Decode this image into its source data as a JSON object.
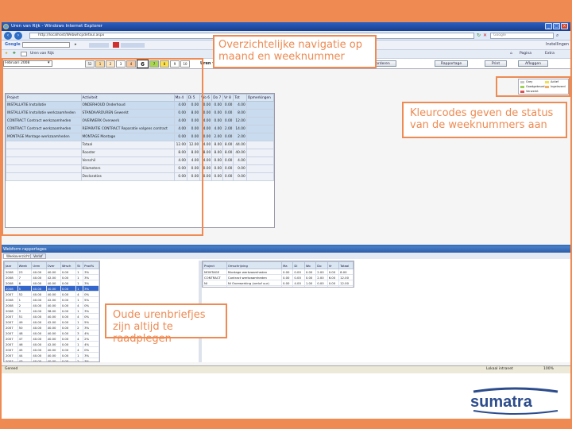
{
  "browser": {
    "title": "Uren van Rijk - Windows Internet Explorer",
    "url": "http://localhost/Webwhcpdefaul.aspx",
    "search_placeholder": "Google",
    "google_label": "Google",
    "favorites_item": "Uren van Rijk",
    "page_menu": "Pagina",
    "extra_menu": "Extra",
    "tools_menu": "Instellingen"
  },
  "app": {
    "week_select": "Februari 2008",
    "weeks": [
      "52",
      "1",
      "2",
      "3",
      "4",
      "6",
      "7",
      "8",
      "9",
      "10"
    ],
    "selected_week": "6",
    "header_text": "Uren van Rijk",
    "btn_accorderen": "Accorderen",
    "btn_rapportage": "Rapportage",
    "btn_print": "Print",
    "btn_afloggen": "Afloggen",
    "week_colors": {
      "52": "#f4f4f4",
      "1": "#f8d7a0",
      "2": "#fde6c4",
      "3": "#ffffff",
      "4": "#f9c79a",
      "6": "#ffffff",
      "7": "#a8d650",
      "8": "#fbe04a",
      "9": "#ffffff",
      "10": "#ffffff"
    }
  },
  "legend": {
    "items": [
      {
        "label": "Grey",
        "color": "#c8c8c8"
      },
      {
        "label": "Actief",
        "color": "#f0e050"
      },
      {
        "label": "Goedgekeurd",
        "color": "#9ccf55"
      },
      {
        "label": "Ingeleverd",
        "color": "#f0b060"
      },
      {
        "label": "Verwerkt",
        "color": "#e05050"
      }
    ]
  },
  "hours_table": {
    "headers": [
      "Project",
      "Activiteit",
      "Ma 4",
      "Di 5",
      "Wo 6",
      "Do 7",
      "Vr 8",
      "Tot",
      "Opmerkingen"
    ],
    "rows": [
      {
        "project": "INSTALLATIE Installatie",
        "activity": "ONDERHOUD Onderhoud",
        "vals": [
          "4.00",
          "0.00",
          "0.00",
          "0.00",
          "0.00",
          "4.00"
        ]
      },
      {
        "project": "INSTALLATIE Installatie werkzaamheden",
        "activity": "STANDAARDUREN Gewerkt",
        "vals": [
          "0.00",
          "8.00",
          "0.00",
          "0.00",
          "0.00",
          "8.00"
        ]
      },
      {
        "project": "CONTRACT Contract werkzaamheden",
        "activity": "OVERWERK Overwerk",
        "vals": [
          "4.00",
          "0.00",
          "4.00",
          "0.00",
          "0.00",
          "12.00"
        ]
      },
      {
        "project": "CONTRACT Contract werkzaamheden",
        "activity": "REPARATIE CONTRACT Reparatie volgens contract",
        "vals": [
          "4.00",
          "0.00",
          "4.00",
          "4.00",
          "2.00",
          "14.00"
        ]
      },
      {
        "project": "MONTAGE Montage werkzaamheden",
        "activity": "MONTAGE Montage",
        "vals": [
          "0.00",
          "0.00",
          "0.00",
          "2.00",
          "0.00",
          "2.00"
        ]
      }
    ],
    "summary": [
      {
        "label": "Totaal",
        "vals": [
          "12.00",
          "12.00",
          "4.00",
          "8.00",
          "8.00",
          "44.00"
        ]
      },
      {
        "label": "Rooster",
        "vals": [
          "8.00",
          "8.00",
          "8.00",
          "8.00",
          "8.00",
          "40.00"
        ]
      },
      {
        "label": "Verschil",
        "vals": [
          "4.00",
          "4.00",
          "-4.00",
          "0.00",
          "0.00",
          "4.00"
        ]
      },
      {
        "label": "Kilometers",
        "vals": [
          "0.00",
          "0.00",
          "0.00",
          "0.00",
          "0.00",
          "0.00"
        ]
      },
      {
        "label": "Declaraties",
        "vals": [
          "0.00",
          "0.00",
          "0.00",
          "0.00",
          "0.00",
          "0.00"
        ]
      }
    ]
  },
  "bottom": {
    "title": "Webform rapportages",
    "tabs": [
      "Weekoverzicht",
      "Verlof"
    ],
    "week_headers": [
      "Jaar",
      "Week",
      "Uren",
      "Over",
      "Wrsch",
      "St",
      "Prod%"
    ],
    "week_rows": [
      [
        "2008",
        "23",
        "40.00",
        "40.00",
        "0.00",
        "1",
        "3%"
      ],
      [
        "2008",
        "7",
        "40.00",
        "42.00",
        "0.00",
        "1",
        "3%"
      ],
      [
        "2008",
        "6",
        "40.00",
        "40.00",
        "0.00",
        "1",
        "3%"
      ],
      [
        "2008",
        "5",
        "40.00",
        "40.00",
        "0.00",
        "1",
        "3%"
      ],
      [
        "2007",
        "52",
        "40.00",
        "40.00",
        "0.00",
        "4",
        "0%"
      ],
      [
        "2008",
        "1",
        "40.00",
        "42.00",
        "0.00",
        "1",
        "5%"
      ],
      [
        "2008",
        "2",
        "40.00",
        "40.00",
        "0.00",
        "4",
        "0%"
      ],
      [
        "2008",
        "3",
        "40.00",
        "38.00",
        "0.00",
        "1",
        "3%"
      ],
      [
        "2007",
        "51",
        "40.00",
        "40.00",
        "0.00",
        "4",
        "0%"
      ],
      [
        "2007",
        "49",
        "40.00",
        "42.00",
        "0.00",
        "1",
        "5%"
      ],
      [
        "2007",
        "50",
        "40.00",
        "40.00",
        "0.00",
        "2",
        "3%"
      ],
      [
        "2007",
        "48",
        "40.00",
        "40.00",
        "0.00",
        "3",
        "4%"
      ],
      [
        "2007",
        "47",
        "40.00",
        "40.00",
        "0.00",
        "4",
        "2%"
      ],
      [
        "2007",
        "46",
        "40.00",
        "42.00",
        "0.00",
        "1",
        "4%"
      ],
      [
        "2007",
        "45",
        "40.00",
        "40.00",
        "0.00",
        "4",
        "0%"
      ],
      [
        "2007",
        "44",
        "40.00",
        "40.00",
        "0.00",
        "1",
        "3%"
      ],
      [
        "2007",
        "43",
        "40.00",
        "40.00",
        "0.00",
        "2",
        "3%"
      ],
      [
        "2007",
        "42",
        "40.00",
        "40.00",
        "0.00",
        "1",
        "5%"
      ],
      [
        "2007",
        "41",
        "40.00",
        "40.00",
        "0.00",
        "1",
        "4%"
      ],
      [
        "2007",
        "40",
        "40.00",
        "40.00",
        "0.00",
        "1",
        "3%"
      ],
      [
        "2007",
        "39",
        "40.00",
        "40.00",
        "0.00",
        "1",
        "3%"
      ],
      [
        "2007",
        "38",
        "40.00",
        "40.00",
        "0.00",
        "4",
        "2%"
      ],
      [
        "2007",
        "37",
        "40.00",
        "42.00",
        "0.00",
        "1",
        "3%"
      ],
      [
        "2007",
        "36",
        "40.00",
        "40.00",
        "0.00",
        "1",
        "3%"
      ],
      [
        "2007",
        "35",
        "40.00",
        "40.00",
        "0.00",
        "1",
        "3%"
      ],
      [
        "2007",
        "34",
        "40.00",
        "40.00",
        "0.00",
        "1",
        "3%"
      ]
    ],
    "selected_row": 3,
    "proj_headers": [
      "Project",
      "Omschrijving",
      "Ma",
      "Di",
      "Wo",
      "Do",
      "Vr",
      "Totaal"
    ],
    "proj_rows": [
      [
        "MONTAGE",
        "Montage werkzaamheden",
        "0.00",
        "0.00",
        "0.00",
        "2.00",
        "0.00",
        "8.00"
      ],
      [
        "CONTRACT",
        "Contract werkzaamheden",
        "0.00",
        "0.00",
        "0.00",
        "2.00",
        "6.00",
        "12.00"
      ],
      [
        "NI",
        "Ni Overwerking (verlof uur)",
        "0.00",
        "4.00",
        "1.00",
        "0.00",
        "0.00",
        "12.00"
      ],
      [
        "",
        "",
        "4.00",
        "0.00",
        "4.00",
        "0.00",
        "8.00",
        "40.00"
      ]
    ]
  },
  "status": {
    "left": "Gereed",
    "zone": "Lokaal intranet",
    "zoom": "100%"
  },
  "callouts": {
    "nav": "Overzichtelijke navigatie op maand en weeknummer",
    "colors": "Kleurcodes geven de status van de weeknummers aan",
    "history": "Oude urenbriefjes zijn altijd te raadplegen"
  },
  "logo": {
    "text": "sumatra"
  }
}
